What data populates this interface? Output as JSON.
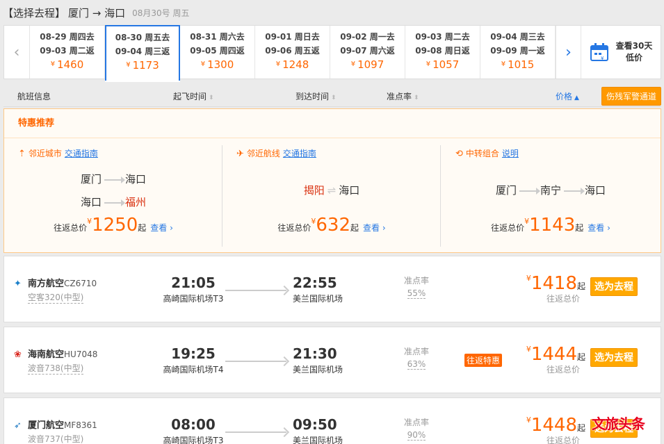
{
  "header": {
    "title": "【选择去程】",
    "route": "厦门 → 海口",
    "date": "08月30号 周五"
  },
  "date_strip": {
    "cells": [
      {
        "outbound": "08-29 周四去",
        "return": "09-03 周二返",
        "price": "1460",
        "active": false
      },
      {
        "outbound": "08-30 周五去",
        "return": "09-04 周三返",
        "price": "1173",
        "active": true
      },
      {
        "outbound": "08-31 周六去",
        "return": "09-05 周四返",
        "price": "1300",
        "active": false
      },
      {
        "outbound": "09-01 周日去",
        "return": "09-06 周五返",
        "price": "1248",
        "active": false
      },
      {
        "outbound": "09-02 周一去",
        "return": "09-07 周六返",
        "price": "1097",
        "active": false
      },
      {
        "outbound": "09-03 周二去",
        "return": "09-08 周日返",
        "price": "1057",
        "active": false
      },
      {
        "outbound": "09-04 周三去",
        "return": "09-09 周一返",
        "price": "1015",
        "active": false
      }
    ],
    "yen": "¥",
    "calendar_line1": "查看30天",
    "calendar_line2": "低价",
    "prev_icon": "chevron-left",
    "next_icon": "chevron-right"
  },
  "sort_bar": {
    "flight_info": "航班信息",
    "departure": "起飞时间",
    "arrival": "到达时间",
    "on_time": "准点率",
    "price": "价格",
    "military": "伤残军警通道"
  },
  "promo": {
    "title": "特惠推荐",
    "col1": {
      "label": "邻近城市",
      "link": "交通指南",
      "route1_from": "厦门",
      "route1_to": "海口",
      "route2_from": "海口",
      "route2_to": "福州",
      "total_label": "往返总价",
      "price": "1250",
      "qi": "起",
      "see": "查看"
    },
    "col2": {
      "label": "邻近航线",
      "link": "交通指南",
      "from": "揭阳",
      "to": "海口",
      "total_label": "往返总价",
      "price": "632",
      "qi": "起",
      "see": "查看"
    },
    "col3": {
      "label": "中转组合",
      "link": "说明",
      "a": "厦门",
      "b": "南宁",
      "c": "海口",
      "total_label": "往返总价",
      "price": "1143",
      "qi": "起",
      "see": "查看"
    },
    "yen": "¥"
  },
  "flights": [
    {
      "airline": "南方航空",
      "code": "CZ6710",
      "plane": "空客320(中型)",
      "dep_time": "21:05",
      "dep_airport": "高崎国际机场T3",
      "arr_time": "22:55",
      "arr_airport": "美兰国际机场",
      "ontime_label": "准点率",
      "ontime": "55%",
      "tag": "",
      "price": "1418",
      "qi": "起",
      "total": "往返总价",
      "select": "选为去程",
      "logo_color": "#1a7fc9"
    },
    {
      "airline": "海南航空",
      "code": "HU7048",
      "plane": "波音738(中型)",
      "dep_time": "19:25",
      "dep_airport": "高崎国际机场T4",
      "arr_time": "21:30",
      "arr_airport": "美兰国际机场",
      "ontime_label": "准点率",
      "ontime": "63%",
      "tag": "往返特惠",
      "price": "1444",
      "qi": "起",
      "total": "往返总价",
      "select": "选为去程",
      "logo_color": "#d9241b"
    },
    {
      "airline": "厦门航空",
      "code": "MF8361",
      "plane": "波音737(中型)",
      "dep_time": "08:00",
      "dep_airport": "高崎国际机场T3",
      "arr_time": "09:50",
      "arr_airport": "美兰国际机场",
      "ontime_label": "准点率",
      "ontime": "90%",
      "tag": "",
      "price": "1448",
      "qi": "起",
      "total": "往返总价",
      "select": "选为去程",
      "logo_color": "#1d79c3"
    }
  ],
  "watermark": "文旅头条",
  "colors": {
    "accent": "#2577e3",
    "price": "#ff6600",
    "button": "#ffa800"
  }
}
